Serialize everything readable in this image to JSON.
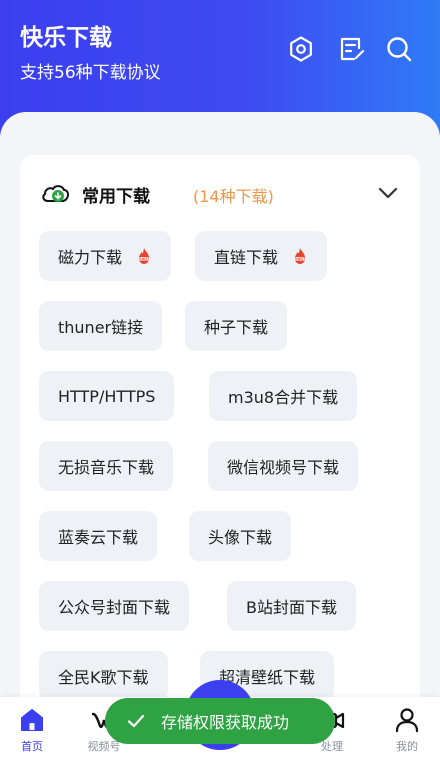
{
  "header": {
    "title": "快乐下载",
    "subtitle": "支持56种下载协议",
    "icons": [
      "settings-icon",
      "edit-note-icon",
      "search-icon"
    ]
  },
  "card": {
    "title": "常用下载",
    "count": "(14种下载)",
    "chips": [
      {
        "label": "磁力下载",
        "hot": true
      },
      {
        "label": "直链下载",
        "hot": true
      },
      {
        "label": "thuner链接",
        "hot": false
      },
      {
        "label": "种子下载",
        "hot": false
      },
      {
        "label": "HTTP/HTTPS",
        "hot": false
      },
      {
        "label": "m3u8合并下载",
        "hot": false
      },
      {
        "label": "无损音乐下载",
        "hot": false
      },
      {
        "label": "微信视频号下载",
        "hot": false
      },
      {
        "label": "蓝奏云下载",
        "hot": false
      },
      {
        "label": "头像下载",
        "hot": false
      },
      {
        "label": "公众号封面下载",
        "hot": false
      },
      {
        "label": "B站封面下载",
        "hot": false
      },
      {
        "label": "全民K歌下载",
        "hot": false
      },
      {
        "label": "超清壁纸下载",
        "hot": false
      }
    ]
  },
  "tabbar": {
    "tabs": [
      {
        "label": "首页",
        "icon": "home-icon",
        "active": true
      },
      {
        "label": "视频号",
        "icon": "video-channel-icon",
        "active": false
      },
      {
        "label": "处理",
        "icon": "video-process-icon",
        "active": false
      },
      {
        "label": "我的",
        "icon": "person-icon",
        "active": false
      }
    ]
  },
  "toast": {
    "text": "存储权限获取成功"
  },
  "colors": {
    "brand": "#3b3ff0",
    "accent": "#f0964a",
    "success": "#2fa344",
    "hot": "#e8432f"
  }
}
